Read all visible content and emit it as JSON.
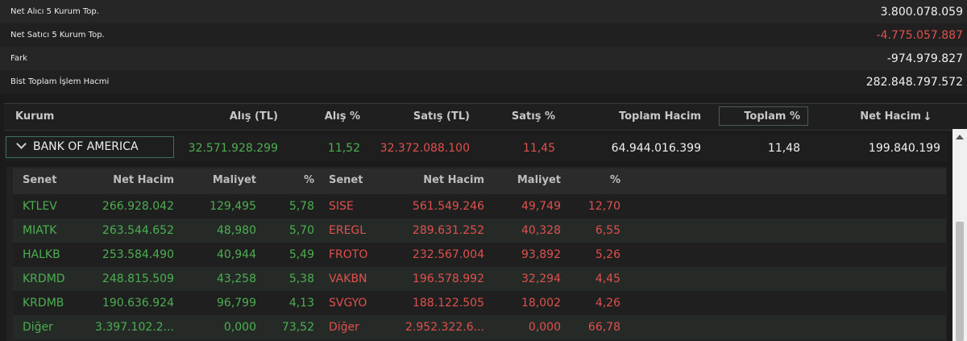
{
  "summary": [
    {
      "label": "Net Alıcı 5 Kurum Top.",
      "value": "3.800.078.059",
      "negative": false
    },
    {
      "label": "Net Satıcı 5 Kurum Top.",
      "value": "-4.775.057.887",
      "negative": true
    },
    {
      "label": "Fark",
      "value": "-974.979.827",
      "negative": false
    },
    {
      "label": "Bist Toplam İşlem Hacmi",
      "value": "282.848.797.572",
      "negative": false
    }
  ],
  "main_table": {
    "headers": {
      "kurum": "Kurum",
      "alis_tl": "Alış (TL)",
      "alis_pct": "Alış %",
      "satis_tl": "Satış (TL)",
      "satis_pct": "Satış %",
      "toplam_hacim": "Toplam Hacim",
      "toplam_pct": "Toplam %",
      "net_hacim": "Net Hacim",
      "sort_icon": "arrow-down-icon"
    },
    "row": {
      "name": "BANK OF AMERICA",
      "alis_tl": "32.571.928.299",
      "alis_pct": "11,52",
      "satis_tl": "32.372.088.100",
      "satis_pct": "11,45",
      "toplam_hacim": "64.944.016.399",
      "toplam_pct": "11,48",
      "net_hacim": "199.840.199"
    }
  },
  "sub_table": {
    "headers": [
      "Senet",
      "Net Hacim",
      "Maliyet",
      "%",
      "Senet",
      "Net Hacim",
      "Maliyet",
      "%"
    ],
    "rows": [
      {
        "buy": [
          "KTLEV",
          "266.928.042",
          "129,495",
          "5,78"
        ],
        "sell": [
          "SISE",
          "561.549.246",
          "49,749",
          "12,70"
        ]
      },
      {
        "buy": [
          "MIATK",
          "263.544.652",
          "48,980",
          "5,70"
        ],
        "sell": [
          "EREGL",
          "289.631.252",
          "40,328",
          "6,55"
        ]
      },
      {
        "buy": [
          "HALKB",
          "253.584.490",
          "40,944",
          "5,49"
        ],
        "sell": [
          "FROTO",
          "232.567.004",
          "93,892",
          "5,26"
        ]
      },
      {
        "buy": [
          "KRDMD",
          "248.815.509",
          "43,258",
          "5,38"
        ],
        "sell": [
          "VAKBN",
          "196.578.992",
          "32,294",
          "4,45"
        ]
      },
      {
        "buy": [
          "KRDMB",
          "190.636.924",
          "96,799",
          "4,13"
        ],
        "sell": [
          "SVGYO",
          "188.122.505",
          "18,002",
          "4,26"
        ]
      },
      {
        "buy": [
          "Diğer",
          "3.397.102.2...",
          "0,000",
          "73,52"
        ],
        "sell": [
          "Diğer",
          "2.952.322.6...",
          "0,000",
          "66,78"
        ]
      }
    ]
  },
  "colors": {
    "buy": "#4caf50",
    "sell": "#e0504c",
    "accent_border": "#3f6f68"
  }
}
